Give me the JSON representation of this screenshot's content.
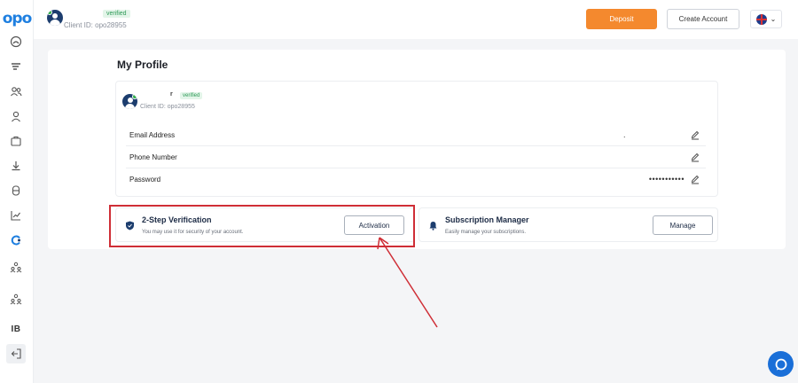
{
  "brand": {
    "logo_text": "opo"
  },
  "header": {
    "verified_label": "verified",
    "client_id": "Client ID: opo28955",
    "deposit_label": "Deposit",
    "create_account_label": "Create Account",
    "language": "en-GB"
  },
  "sidebar": {
    "ib_label": "IB"
  },
  "profile": {
    "title": "My Profile",
    "name_mark": "r",
    "verified_label": "verified",
    "client_id": "Client ID: opo28955",
    "fields": [
      {
        "label": "Email Address",
        "value": "."
      },
      {
        "label": "Phone Number",
        "value": ""
      },
      {
        "label": "Password",
        "value": "•••••••••••"
      }
    ]
  },
  "features": {
    "two_step": {
      "title": "2-Step Verification",
      "description": "You may use it for security of your account.",
      "button": "Activation"
    },
    "subscription": {
      "title": "Subscription Manager",
      "description": "Easily manage your subscriptions.",
      "button": "Manage"
    }
  },
  "colors": {
    "accent": "#f4892e",
    "brand": "#1e7fe0",
    "highlight": "#cf2e36",
    "verified": "#2e9a57"
  }
}
